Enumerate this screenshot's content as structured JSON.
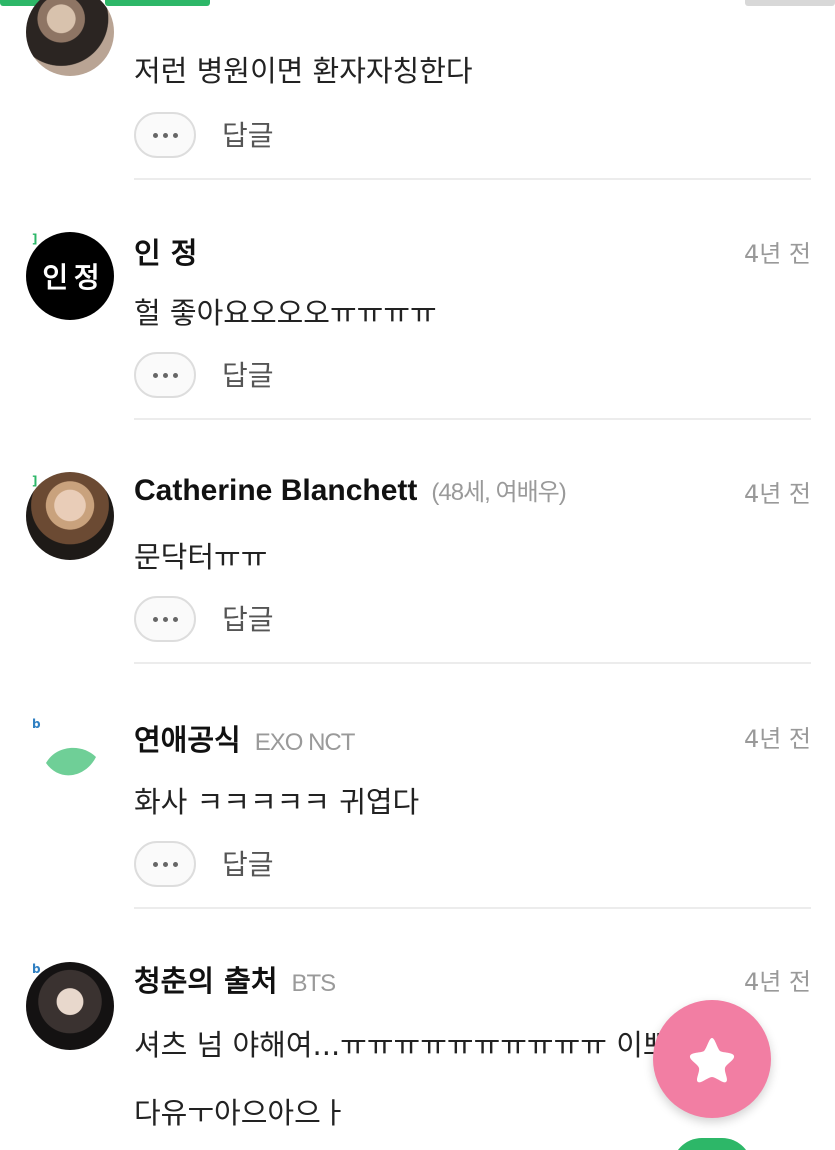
{
  "top_partial": {
    "text": "저런 병원이면 환자자칭한다",
    "reply_label": "답글"
  },
  "comments": [
    {
      "name": "인 정",
      "meta": "",
      "time": "4년 전",
      "text": "헐 좋아요오오오ㅠㅠㅠㅠ",
      "reply_label": "답글",
      "avatar_text": "인 정"
    },
    {
      "name": "Catherine Blanchett",
      "meta": "(48세, 여배우)",
      "time": "4년 전",
      "text": "문닥터ㅠㅠ",
      "reply_label": "답글"
    },
    {
      "name": "연애공식",
      "meta": "EXO NCT",
      "time": "4년 전",
      "text": "화사 ㅋㅋㅋㅋㅋ 귀엽다",
      "reply_label": "답글"
    },
    {
      "name": "청춘의 출처",
      "meta": "BTS",
      "time": "4년 전",
      "text": "셔츠 넘 야해여...ㅠㅠㅠㅠㅠㅠㅠㅠㅠㅠ 이쁘",
      "text2": "다유ㅜ아으아으ㅏ"
    }
  ],
  "colors": {
    "accent_green": "#2db768",
    "fab_pink": "#f27ea3",
    "muted_text": "#999999"
  },
  "icons": {
    "more": "more-dots-icon",
    "fab": "star-icon",
    "leaf": "leaf-icon"
  }
}
